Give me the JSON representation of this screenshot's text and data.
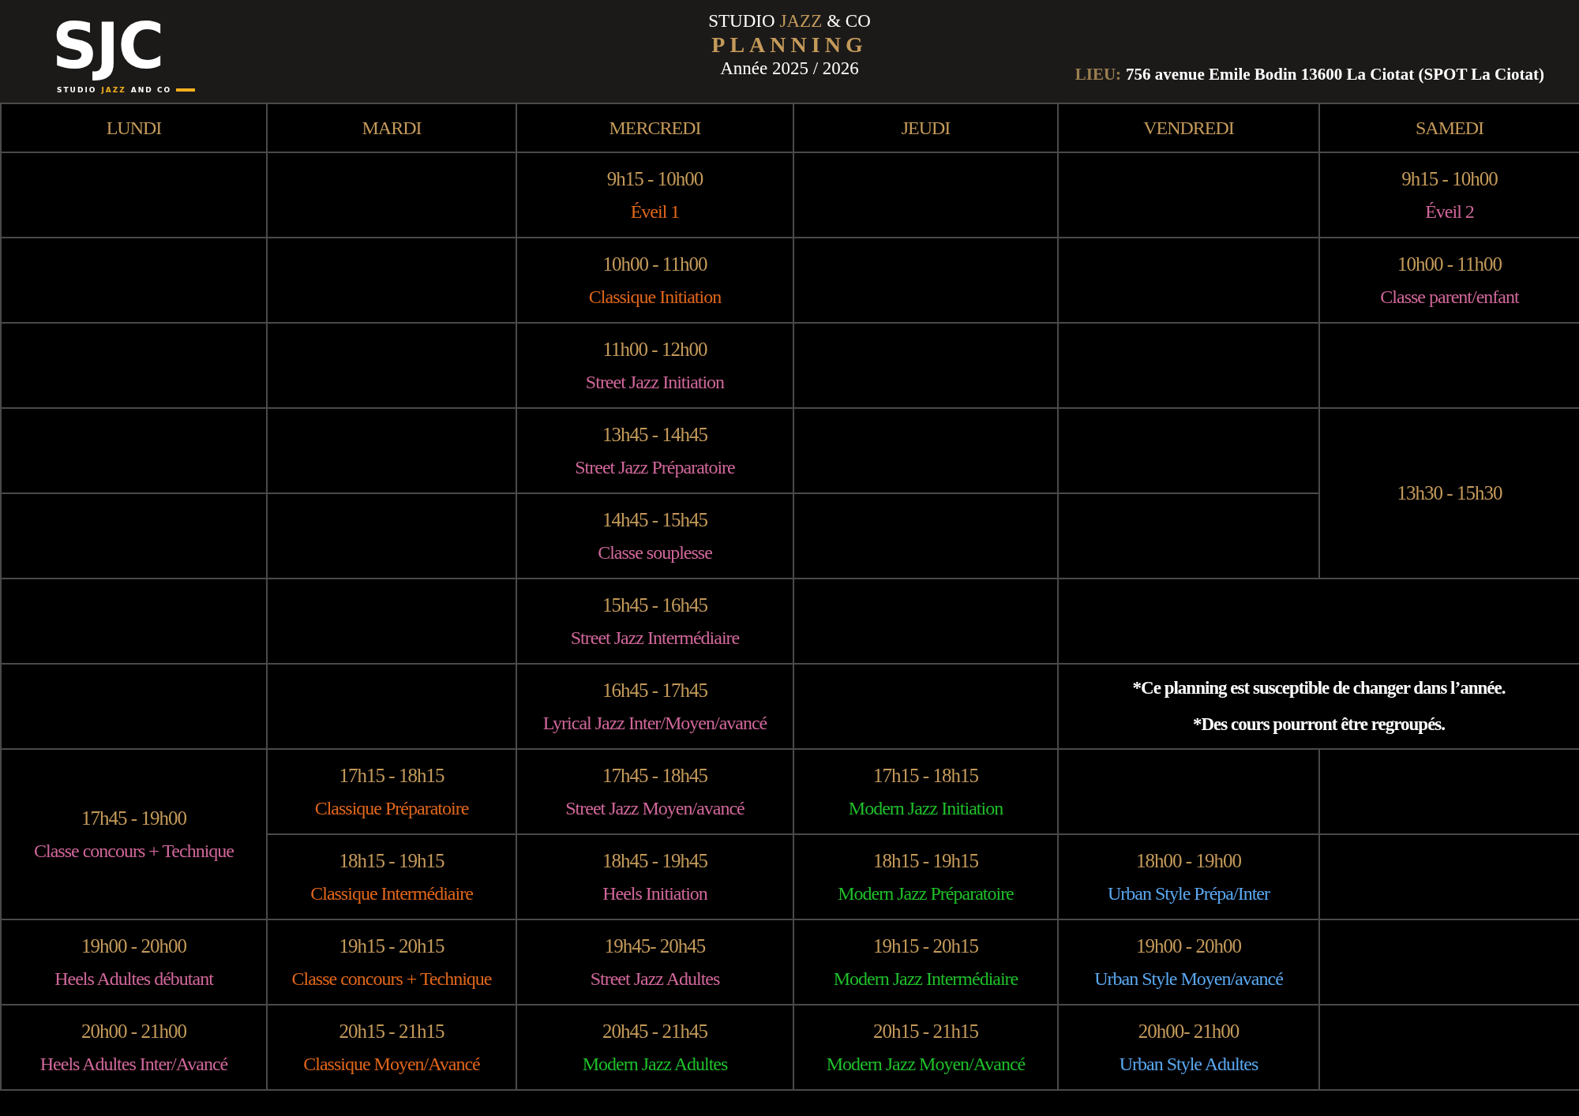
{
  "logo": {
    "letters": "SJC",
    "tagline": [
      {
        "text": "STUDIO",
        "accent": false
      },
      {
        "text": "JAZZ",
        "accent": true
      },
      {
        "text": "AND CO",
        "accent": false
      }
    ]
  },
  "header": {
    "title": [
      {
        "text": "STUDIO",
        "accent": false
      },
      {
        "text": "JAZZ",
        "accent": true
      },
      {
        "text": "& CO",
        "accent": false
      }
    ],
    "heading": "PLANNING",
    "year": "Année 2025 / 2026",
    "location_label": "LIEU:",
    "location": "756 avenue Emile Bodin 13600 La Ciotat (SPOT La Ciotat)"
  },
  "table": {
    "columns": [
      "LUNDI",
      "MARDI",
      "MERCREDI",
      "JEUDI",
      "VENDREDI",
      "SAMEDI"
    ],
    "rows": [
      [
        {
          "kind": "empty"
        },
        {
          "kind": "empty"
        },
        {
          "kind": "class",
          "time": "9h15 - 10h00",
          "name": "Éveil 1",
          "color": "#e0661a"
        },
        {
          "kind": "empty"
        },
        {
          "kind": "empty"
        },
        {
          "kind": "class",
          "time": "9h15 - 10h00",
          "name": "Éveil 2",
          "color": "#d0679a"
        }
      ],
      [
        {
          "kind": "empty"
        },
        {
          "kind": "empty"
        },
        {
          "kind": "class",
          "time": "10h00 - 11h00",
          "name": "Classique Initiation",
          "color": "#e0661a"
        },
        {
          "kind": "empty"
        },
        {
          "kind": "empty"
        },
        {
          "kind": "class",
          "time": "10h00 - 11h00",
          "name": "Classe parent/enfant",
          "color": "#d0679a"
        }
      ],
      [
        {
          "kind": "empty"
        },
        {
          "kind": "empty"
        },
        {
          "kind": "class",
          "time": "11h00 - 12h00",
          "name": "Street Jazz Initiation",
          "color": "#d0679a"
        },
        {
          "kind": "empty"
        },
        {
          "kind": "empty"
        },
        {
          "kind": "empty"
        }
      ],
      [
        {
          "kind": "empty"
        },
        {
          "kind": "empty"
        },
        {
          "kind": "class",
          "time": "13h45 - 14h45",
          "name": "Street Jazz Préparatoire",
          "color": "#d0679a"
        },
        {
          "kind": "empty"
        },
        {
          "kind": "empty"
        },
        {
          "kind": "time",
          "time": "13h30 - 15h30",
          "rowspan": 2
        }
      ],
      [
        {
          "kind": "empty"
        },
        {
          "kind": "empty"
        },
        {
          "kind": "class",
          "time": "14h45 - 15h45",
          "name": "Classe souplesse",
          "color": "#d0679a"
        },
        {
          "kind": "empty"
        },
        {
          "kind": "empty"
        }
      ],
      [
        {
          "kind": "empty"
        },
        {
          "kind": "empty"
        },
        {
          "kind": "class",
          "time": "15h45 - 16h45",
          "name": "Street Jazz Intermédiaire",
          "color": "#d0679a"
        },
        {
          "kind": "empty"
        },
        {
          "kind": "empty",
          "colspan": 2
        }
      ],
      [
        {
          "kind": "empty"
        },
        {
          "kind": "empty"
        },
        {
          "kind": "class",
          "time": "16h45 - 17h45",
          "name": "Lyrical Jazz Inter/Moyen/avancé",
          "color": "#d0679a"
        },
        {
          "kind": "empty"
        },
        {
          "kind": "note",
          "lines": [
            "*Ce planning est susceptible de changer dans l’année.",
            "*Des cours pourront être regroupés."
          ],
          "colspan": 2
        }
      ],
      [
        {
          "kind": "class",
          "time": "17h45 - 19h00",
          "name": "Classe concours + Technique",
          "color": "#d0679a",
          "rowspan": 2
        },
        {
          "kind": "class",
          "time": "17h15 - 18h15",
          "name": "Classique Préparatoire",
          "color": "#e0661a"
        },
        {
          "kind": "class",
          "time": "17h45 - 18h45",
          "name": "Street Jazz Moyen/avancé",
          "color": "#d0679a"
        },
        {
          "kind": "class",
          "time": "17h15 - 18h15",
          "name": "Modern Jazz Initiation",
          "color": "#1fbf2a"
        },
        {
          "kind": "empty"
        },
        {
          "kind": "empty"
        }
      ],
      [
        {
          "kind": "class",
          "time": "18h15 - 19h15",
          "name": "Classique Intermédiaire",
          "color": "#e0661a"
        },
        {
          "kind": "class",
          "time": "18h45 - 19h45",
          "name": "Heels Initiation",
          "color": "#d0679a"
        },
        {
          "kind": "class",
          "time": "18h15 - 19h15",
          "name": "Modern Jazz Préparatoire",
          "color": "#1fbf2a"
        },
        {
          "kind": "class",
          "time": "18h00 - 19h00",
          "name": "Urban Style Prépa/Inter",
          "color": "#5aa8f0"
        },
        {
          "kind": "empty"
        }
      ],
      [
        {
          "kind": "class",
          "time": "19h00 - 20h00",
          "name": "Heels Adultes débutant",
          "color": "#d0679a"
        },
        {
          "kind": "class",
          "time": "19h15 - 20h15",
          "name": "Classe concours + Technique",
          "color": "#e0661a"
        },
        {
          "kind": "class",
          "time": "19h45- 20h45",
          "name": "Street Jazz Adultes",
          "color": "#d0679a"
        },
        {
          "kind": "class",
          "time": "19h15 - 20h15",
          "name": "Modern Jazz Intermédiaire",
          "color": "#1fbf2a"
        },
        {
          "kind": "class",
          "time": "19h00 - 20h00",
          "name": "Urban Style Moyen/avancé",
          "color": "#5aa8f0"
        },
        {
          "kind": "empty"
        }
      ],
      [
        {
          "kind": "class",
          "time": "20h00 - 21h00",
          "name": "Heels Adultes Inter/Avancé",
          "color": "#d0679a"
        },
        {
          "kind": "class",
          "time": "20h15 - 21h15",
          "name": "Classique Moyen/Avancé",
          "color": "#e0661a"
        },
        {
          "kind": "class",
          "time": "20h45 - 21h45",
          "name": "Modern Jazz Adultes",
          "color": "#1fbf2a"
        },
        {
          "kind": "class",
          "time": "20h15 - 21h15",
          "name": "Modern Jazz Moyen/Avancé",
          "color": "#1fbf2a"
        },
        {
          "kind": "class",
          "time": "20h00- 21h00",
          "name": "Urban Style Adultes",
          "color": "#5aa8f0"
        },
        {
          "kind": "empty"
        }
      ]
    ]
  }
}
